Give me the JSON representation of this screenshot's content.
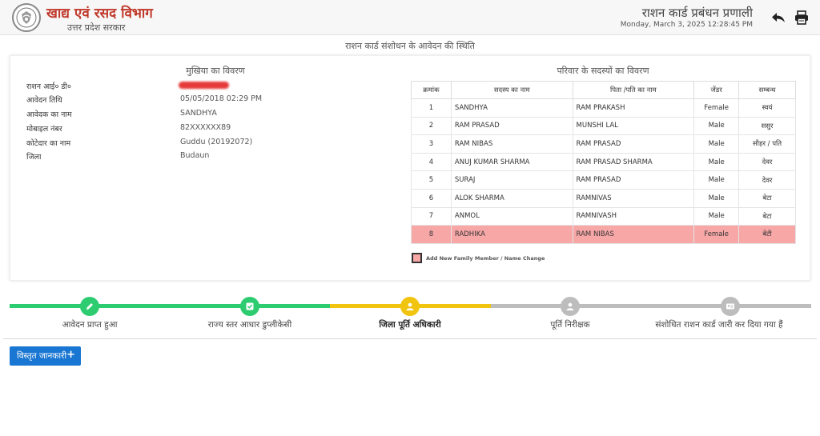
{
  "header": {
    "department": "खाद्य एवं रसद विभाग",
    "government": "उत्तर प्रदेश सरकार",
    "system_title": "राशन कार्ड प्रबंधन प्रणाली",
    "datetime": "Monday, March 3, 2025 12:28:45 PM",
    "icons": {
      "logo": "up-emblem",
      "back": "reply-arrow-icon",
      "print": "printer-icon"
    }
  },
  "page_heading": "राशन कार्ड संशोधन के आवेदन की स्थिति",
  "head_info": {
    "title": "मुखिया का विवरण",
    "rows": [
      {
        "label": "राशन आई० डी०",
        "value": ""
      },
      {
        "label": "आवेदन तिथि",
        "value": "05/05/2018 02:29 PM"
      },
      {
        "label": "आवेदक का नाम",
        "value": "SANDHYA"
      },
      {
        "label": "मोबाइल नंबर",
        "value": "82XXXXXX89"
      },
      {
        "label": "कोटेदार का नाम",
        "value": "Guddu (20192072)"
      },
      {
        "label": "जिला",
        "value": "Budaun"
      }
    ]
  },
  "family": {
    "title": "परिवार के सदस्यों का विवरण",
    "columns": [
      "क्रमांक",
      "सदस्य का नाम",
      "पिता /पति का नाम",
      "जेंडर",
      "सम्बन्ध"
    ],
    "rows": [
      {
        "sno": "1",
        "name": "SANDHYA",
        "father": "RAM PRAKASH",
        "gender": "Female",
        "relation": "स्वयं",
        "highlight": false
      },
      {
        "sno": "2",
        "name": "RAM PRASAD",
        "father": "MUNSHI LAL",
        "gender": "Male",
        "relation": "ससुर",
        "highlight": false
      },
      {
        "sno": "3",
        "name": "RAM NIBAS",
        "father": "RAM PRASAD",
        "gender": "Male",
        "relation": "सौहर / पति",
        "highlight": false
      },
      {
        "sno": "4",
        "name": "ANUJ KUMAR SHARMA",
        "father": "RAM PRASAD SHARMA",
        "gender": "Male",
        "relation": "देवर",
        "highlight": false
      },
      {
        "sno": "5",
        "name": "SURAJ",
        "father": "RAM PRASAD",
        "gender": "Male",
        "relation": "देवर",
        "highlight": false
      },
      {
        "sno": "6",
        "name": "ALOK SHARMA",
        "father": "RAMNIVAS",
        "gender": "Male",
        "relation": "बेटा",
        "highlight": false
      },
      {
        "sno": "7",
        "name": "ANMOL",
        "father": "RAMNIVASH",
        "gender": "Male",
        "relation": "बेटा",
        "highlight": false
      },
      {
        "sno": "8",
        "name": "RADHIKA",
        "father": "RAM NIBAS",
        "gender": "Female",
        "relation": "बेटी",
        "highlight": true
      }
    ],
    "legend": "Add New Family Member / Name Change",
    "highlight_color": "#f8a7a7"
  },
  "progress": {
    "steps": [
      {
        "label": "आवेदन प्राप्त हुआ",
        "status": "done",
        "icon": "pencil-icon",
        "color": "#2ecc71"
      },
      {
        "label": "राज्य स्तर आधार डुप्लीकेसी",
        "status": "done",
        "icon": "check-square-icon",
        "color": "#2ecc71"
      },
      {
        "label": "जिला पूर्ति अधिकारी",
        "status": "current",
        "icon": "user-icon",
        "color": "#f1c40f"
      },
      {
        "label": "पूर्ति निरीक्षक",
        "status": "pending",
        "icon": "user-icon",
        "color": "#bdbdbd"
      },
      {
        "label": "संशोधित राशन कार्ड जारी कर दिया गया हैं",
        "status": "pending",
        "icon": "id-card-icon",
        "color": "#bdbdbd"
      }
    ]
  },
  "details_button": {
    "label": "विस्तृत जानकारी",
    "icon": "plus-icon"
  }
}
